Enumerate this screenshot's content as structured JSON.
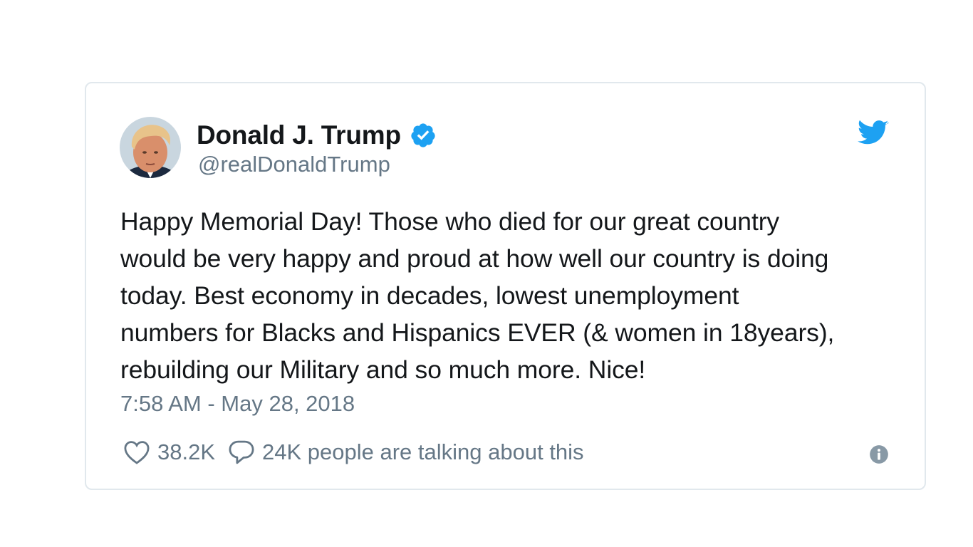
{
  "tweet": {
    "display_name": "Donald J. Trump",
    "handle": "@realDonaldTrump",
    "verified": true,
    "text": "Happy Memorial Day! Those who died for our great country\nwould be very happy and proud at how well our country is doing\ntoday. Best economy in decades, lowest unemployment\nnumbers for Blacks and Hispanics EVER (& women in 18years),\nrebuilding our Military and so much more. Nice!",
    "timestamp": "7:58 AM - May 28, 2018",
    "like_count": "38.2K",
    "talking_text": "24K people are talking about this"
  },
  "icons": {
    "avatar": "profile-photo",
    "verified": "verified-badge-icon",
    "brand": "twitter-bird-icon",
    "like": "heart-icon",
    "reply": "speech-bubble-icon",
    "info": "info-icon"
  },
  "colors": {
    "brand_blue": "#1da1f2",
    "text_primary": "#14171a",
    "text_secondary": "#657786",
    "border": "#e1e8ed"
  }
}
